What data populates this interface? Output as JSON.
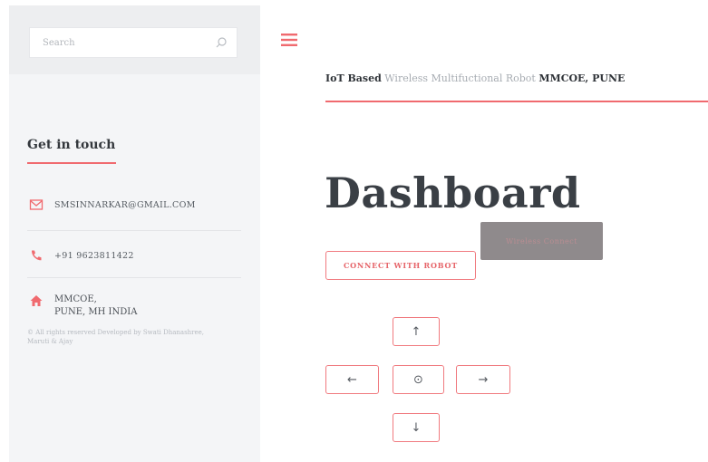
{
  "sidebar": {
    "search_placeholder": "Search",
    "get_in_touch": "Get in touch",
    "email": "SMSINNARKAR@GMAIL.COM",
    "phone": "+91 9623811422",
    "address_line1": "MMCOE,",
    "address_line2": "PUNE, MH INDIA",
    "copyright": "© All rights reserved Developed by Swati Dhanashree, Maruti & Ajay"
  },
  "header": {
    "title_bold1": "IoT Based",
    "title_regular": " Wireless Multifuctional Robot ",
    "title_bold2": "MMCOE, PUNE"
  },
  "main": {
    "page_title": "Dashboard",
    "connect_label": "CONNECT WITH ROBOT",
    "overlay_label": "Wireless Connect"
  },
  "controls": {
    "up": "↑",
    "left": "←",
    "stop": "⊙",
    "right": "→",
    "down": "↓"
  },
  "colors": {
    "accent": "#f06a6f",
    "sidebar_bg": "#f4f5f7"
  }
}
